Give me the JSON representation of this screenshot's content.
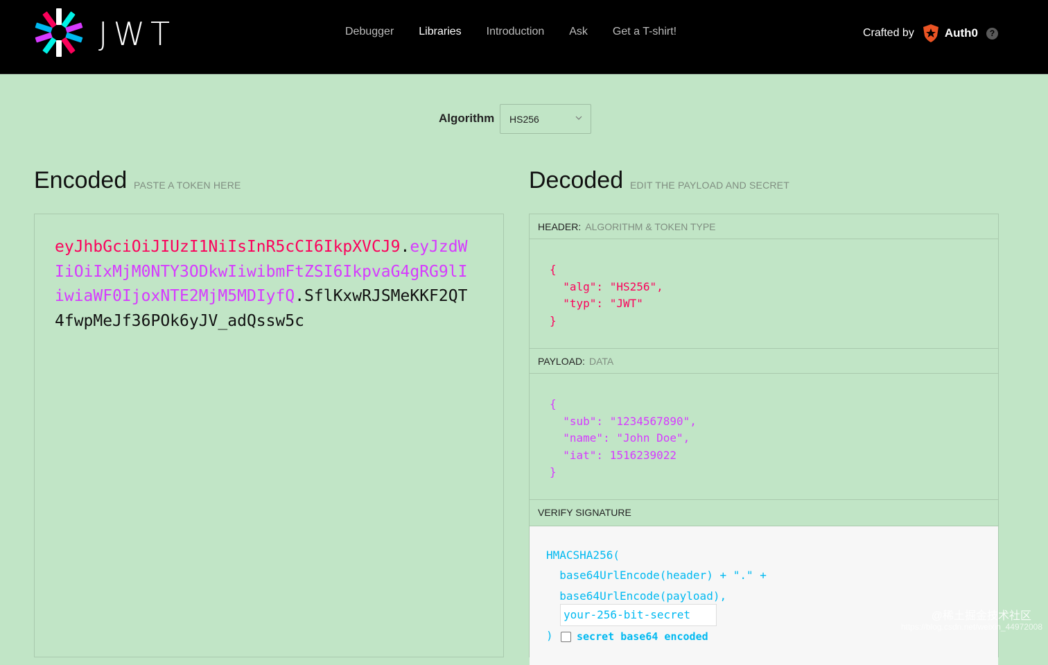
{
  "brand": {
    "logo_text": "JWT"
  },
  "nav": [
    {
      "label": "Debugger",
      "active": false
    },
    {
      "label": "Libraries",
      "active": true
    },
    {
      "label": "Introduction",
      "active": false
    },
    {
      "label": "Ask",
      "active": false
    },
    {
      "label": "Get a T-shirt!",
      "active": false
    }
  ],
  "crafted": {
    "label": "Crafted by",
    "brand": "Auth0",
    "help": "?"
  },
  "algorithm": {
    "label": "Algorithm",
    "selected": "HS256"
  },
  "encoded": {
    "title": "Encoded",
    "subtitle": "PASTE A TOKEN HERE",
    "token_header": "eyJhbGciOiJIUzI1NiIsInR5cCI6IkpXVCJ9",
    "token_payload": "eyJzdWIiOiIxMjM0NTY3ODkwIiwibmFtZSI6IkpvaG4gRG9lIiwiaWF0IjoxNTE2MjM5MDIyfQ",
    "token_signature": "SflKxwRJSMeKKF2QT4fwpMeJf36POk6yJV_adQssw5c",
    "dot": "."
  },
  "decoded": {
    "title": "Decoded",
    "subtitle": "EDIT THE PAYLOAD AND SECRET",
    "header_label": "HEADER:",
    "header_hint": "ALGORITHM & TOKEN TYPE",
    "header_json": "{\n  \"alg\": \"HS256\",\n  \"typ\": \"JWT\"\n}",
    "payload_label": "PAYLOAD:",
    "payload_hint": "DATA",
    "payload_json": "{\n  \"sub\": \"1234567890\",\n  \"name\": \"John Doe\",\n  \"iat\": 1516239022\n}",
    "verify_label": "VERIFY SIGNATURE",
    "verify_code": "HMACSHA256(\n  base64UrlEncode(header) + \".\" +\n  base64UrlEncode(payload),",
    "secret_placeholder": "your-256-bit-secret",
    "close_paren": ")",
    "base64_label": "secret base64 encoded"
  },
  "watermark": {
    "line1": "@稀土掘金技术社区",
    "line2": "https://blog.csdn.net/weixin_44972008"
  },
  "colors": {
    "background": "#c1e5c6",
    "topbar": "#000000",
    "token_header": "#fb015b",
    "token_payload": "#d63aff",
    "verify_code": "#00b9f1",
    "auth0_orange": "#eb5424"
  }
}
